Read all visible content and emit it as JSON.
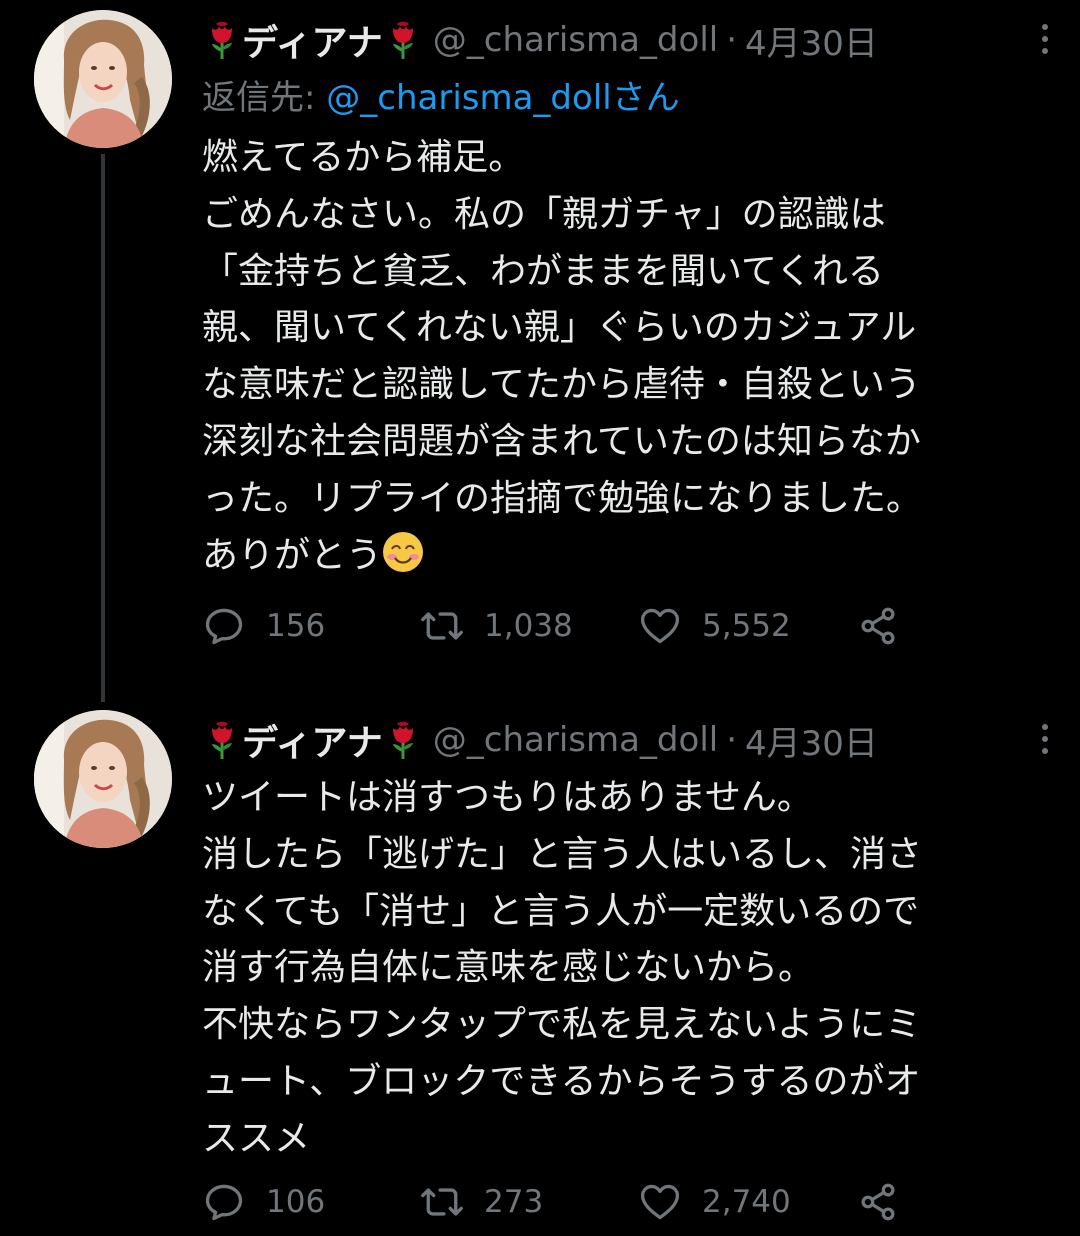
{
  "tweets": [
    {
      "display_name": "ディアナ",
      "handle": "@_charisma_doll",
      "separator": "·",
      "date": "4月30日",
      "reply_to": {
        "prefix": "返信先: ",
        "mention": "@_charisma_dollさん"
      },
      "body_text": "燃えてるから補足。\nごめんなさい。私の「親ガチャ」の認識は\n「金持ちと貧乏、わがままを聞いてくれる\n親、聞いてくれない親」ぐらいのカジュアル\nな意味だと認識してたから虐待・自殺という\n深刻な社会問題が含まれていたのは知らなか\nった。リプライの指摘で勉強になりました。\nありがとう",
      "emoji": "smiling-face-with-smiling-eyes",
      "stats": {
        "replies": "156",
        "retweets": "1,038",
        "likes": "5,552"
      }
    },
    {
      "display_name": "ディアナ",
      "handle": "@_charisma_doll",
      "separator": "·",
      "date": "4月30日",
      "body_text": "ツイートは消すつもりはありません。\n消したら「逃げた」と言う人はいるし、消さ\nなくても「消せ」と言う人が一定数いるので\n消す行為自体に意味を感じないから。\n不快ならワンタップで私を見えないようにミ\nュート、ブロックできるからそうするのがオ\nススメ",
      "stats": {
        "replies": "106",
        "retweets": "273",
        "likes": "2,740"
      }
    }
  ],
  "icons": {
    "rose": "rose-icon",
    "more": "more-icon",
    "reply": "reply-icon",
    "retweet": "retweet-icon",
    "like": "heart-icon",
    "share": "share-icon"
  },
  "colors": {
    "background": "#000000",
    "text": "#e7e9ea",
    "muted": "#71767b",
    "link": "#1d9bf0",
    "thread_line": "#333639"
  }
}
